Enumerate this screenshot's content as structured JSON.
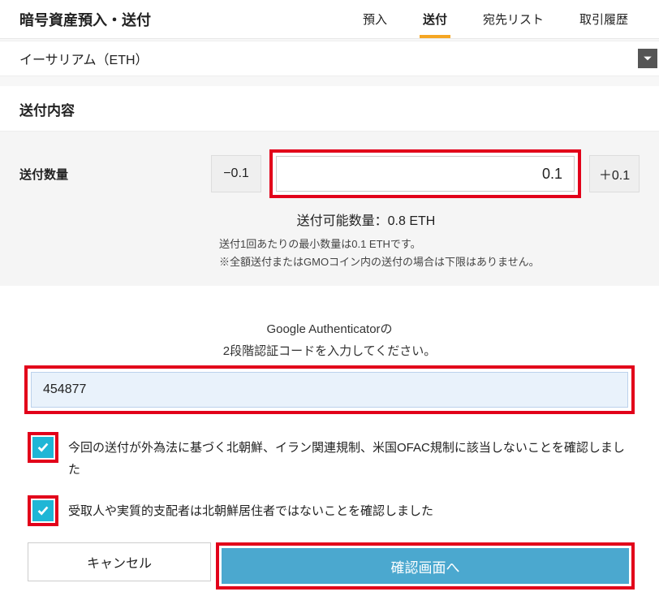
{
  "page_title": "暗号資産預入・送付",
  "tabs": [
    "預入",
    "送付",
    "宛先リスト",
    "取引履歴"
  ],
  "active_tab": 1,
  "asset_select": {
    "value": "イーサリアム（ETH）"
  },
  "section_title": "送付内容",
  "qty": {
    "label": "送付数量",
    "dec": "−0.1",
    "inc": "＋0.1",
    "value": "0.1",
    "available": "送付可能数量：0.8 ETH",
    "note1": "送付1回あたりの最小数量は0.1 ETHです。",
    "note2": "※全額送付またはGMOコイン内の送付の場合は下限はありません。"
  },
  "tfa": {
    "line1": "Google Authenticatorの",
    "line2": "2段階認証コードを入力してください。",
    "value": "454877"
  },
  "checks": {
    "c1": "今回の送付が外為法に基づく北朝鮮、イラン関連規制、米国OFAC規制に該当しないことを確認しました",
    "c2": "受取人や実質的支配者は北朝鮮居住者ではないことを確認しました"
  },
  "buttons": {
    "cancel": "キャンセル",
    "confirm": "確認画面へ"
  }
}
